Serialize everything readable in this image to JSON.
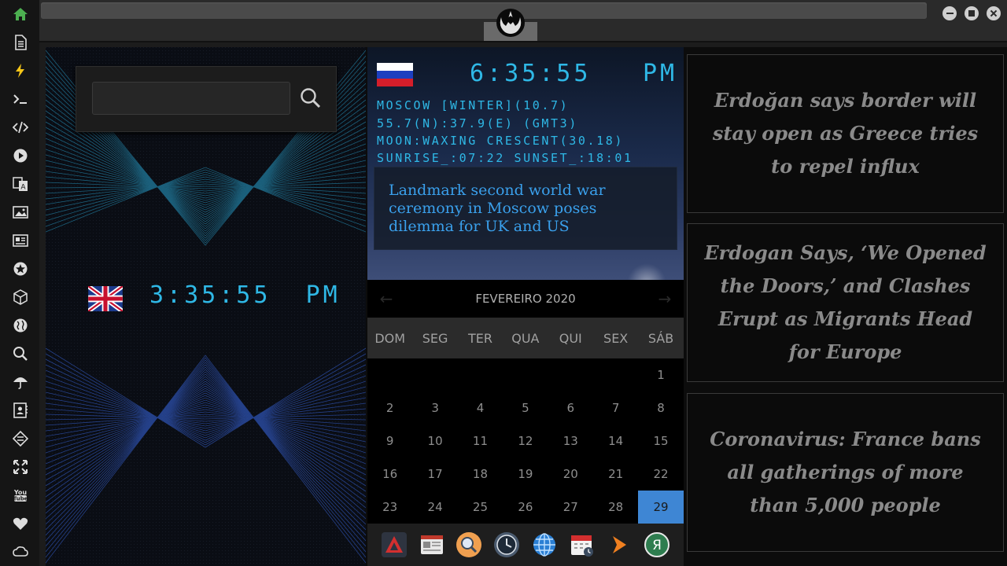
{
  "sidebar": {
    "items": [
      {
        "icon": "home-icon"
      },
      {
        "icon": "document-icon"
      },
      {
        "icon": "lightning-icon"
      },
      {
        "icon": "terminal-icon"
      },
      {
        "icon": "code-icon"
      },
      {
        "icon": "play-icon"
      },
      {
        "icon": "translate-icon"
      },
      {
        "icon": "image-icon"
      },
      {
        "icon": "newspaper-icon"
      },
      {
        "icon": "star-badge-icon"
      },
      {
        "icon": "cube-icon"
      },
      {
        "icon": "globe-icon"
      },
      {
        "icon": "search-icon"
      },
      {
        "icon": "umbrella-icon"
      },
      {
        "icon": "contacts-icon"
      },
      {
        "icon": "exchange-icon"
      },
      {
        "icon": "fullscreen-icon"
      },
      {
        "icon": "youtube-icon"
      },
      {
        "icon": "heart-icon"
      },
      {
        "icon": "cloud-icon"
      }
    ]
  },
  "search": {
    "placeholder": "",
    "value": ""
  },
  "uk_clock": {
    "time": "3:35:55",
    "ampm": "PM"
  },
  "russia": {
    "time": "6:35:55",
    "ampm": "PM",
    "info_lines": [
      "MOSCOW [WINTER](10.7)",
      "55.7(N):37.9(E) (GMT3)",
      "MOON:WAXING CRESCENT(30.18)",
      "SUNRISE_:07:22 SUNSET_:18:01"
    ],
    "headline": "Landmark second world war ceremony in Moscow poses dilemma for UK and US"
  },
  "calendar": {
    "month_label": "FEVEREIRO 2020",
    "prev": "←",
    "next": "→",
    "day_names": [
      "DOM",
      "SEG",
      "TER",
      "QUA",
      "QUI",
      "SEX",
      "SÁB"
    ],
    "weeks": [
      [
        "",
        "",
        "",
        "",
        "",
        "",
        "1"
      ],
      [
        "2",
        "3",
        "4",
        "5",
        "6",
        "7",
        "8"
      ],
      [
        "9",
        "10",
        "11",
        "12",
        "13",
        "14",
        "15"
      ],
      [
        "16",
        "17",
        "18",
        "19",
        "20",
        "21",
        "22"
      ],
      [
        "23",
        "24",
        "25",
        "26",
        "27",
        "28",
        "29"
      ]
    ],
    "today": "29"
  },
  "dock": {
    "apps": [
      {
        "icon": "red-triangle-app-icon"
      },
      {
        "icon": "news-reader-icon"
      },
      {
        "icon": "magnifier-app-icon"
      },
      {
        "icon": "clock-app-icon"
      },
      {
        "icon": "globe-app-icon"
      },
      {
        "icon": "calendar-app-icon"
      },
      {
        "icon": "arrow-app-icon"
      },
      {
        "icon": "yandex-app-icon"
      }
    ],
    "yandex_letter": "Я"
  },
  "news": [
    {
      "headline": "Erdoğan says border will stay open as Greece tries to repel influx"
    },
    {
      "headline": "Erdogan Says, ‘We Opened the Doors,’ and Clashes Erupt as Migrants Head for Europe"
    },
    {
      "headline": "Coronavirus: France bans all gatherings of more than 5,000 people"
    }
  ],
  "colors": {
    "clock": "#2fb8e6",
    "news_text": "#3aa0ec",
    "today_bg": "#3e86d4",
    "home_icon": "#4caf50"
  }
}
